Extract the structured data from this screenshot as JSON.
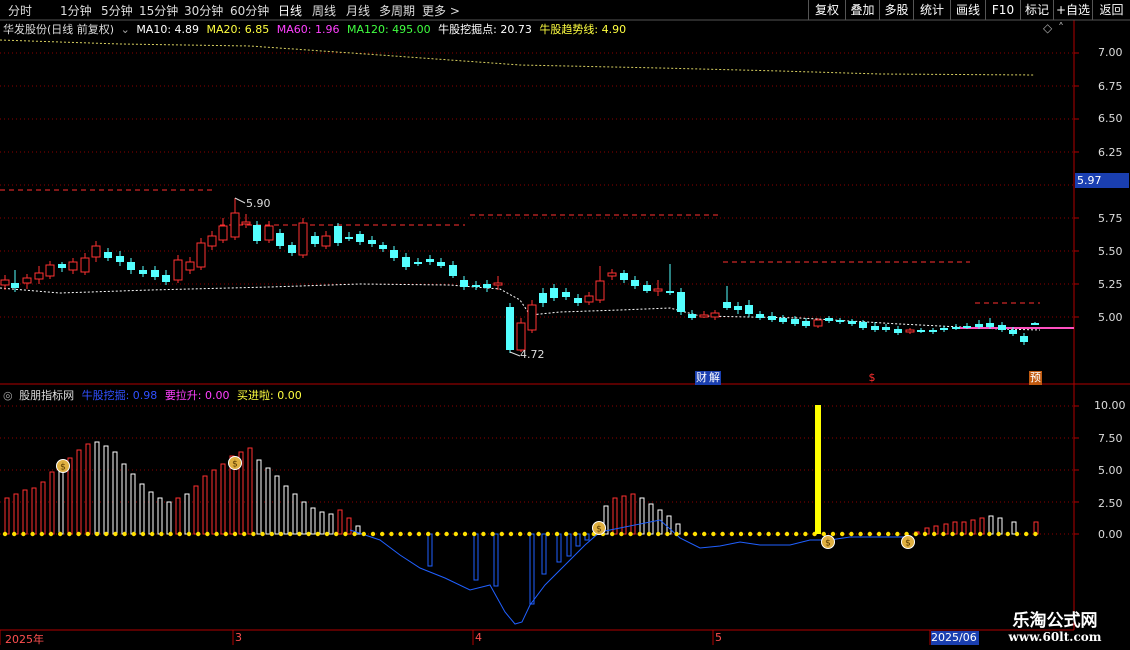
{
  "toolbar": {
    "periods": [
      "分时",
      "1分钟",
      "5分钟",
      "15分钟",
      "30分钟",
      "60分钟",
      "日线",
      "周线",
      "月线",
      "多周期",
      "更多 >"
    ],
    "active_period": "日线",
    "right_buttons": [
      "复权",
      "叠加",
      "多股",
      "统计",
      "画线",
      "F10",
      "标记",
      "+自选",
      "返回"
    ]
  },
  "main_panel": {
    "stock_title": "华发股份(日线 前复权)",
    "indicators": [
      {
        "label": "MA10: 4.89",
        "color": "#ffffff"
      },
      {
        "label": "MA20: 6.85",
        "color": "#ffff40"
      },
      {
        "label": "MA60: 1.96",
        "color": "#ff40ff"
      },
      {
        "label": "MA120: 495.00",
        "color": "#40ff40"
      },
      {
        "label": "牛股挖掘点: 20.73",
        "color": "#ffffff"
      },
      {
        "label": "牛股趋势线: 4.90",
        "color": "#ffff40"
      }
    ],
    "price_axis": [
      "7.00",
      "6.75",
      "6.50",
      "6.25",
      "5.75",
      "5.50",
      "5.25",
      "5.00"
    ],
    "current_price": "5.97",
    "high_mark": "5.90",
    "low_mark": "4.72",
    "event_tags": [
      "财",
      "解",
      "$",
      "预"
    ]
  },
  "sub_panel": {
    "title": "股朋指标网",
    "indicators": [
      {
        "label": "牛股挖掘: 0.98",
        "color": "#3050ff"
      },
      {
        "label": "要拉升: 0.00",
        "color": "#ff40ff"
      },
      {
        "label": "买进啦: 0.00",
        "color": "#ffff40"
      }
    ],
    "value_axis": [
      "10.00",
      "7.50",
      "5.00",
      "2.50",
      "0.00"
    ]
  },
  "date_axis": {
    "labels": [
      "2025年",
      "3",
      "4",
      "5"
    ],
    "end_label": "2025/06"
  },
  "watermark": {
    "line1": "乐淘公式网",
    "line2": "www.60lt.com"
  },
  "colors": {
    "up": "#ff3232",
    "down": "#54ffff",
    "grid": "#8b0000",
    "axis": "#b00000",
    "trend": "#ffff60",
    "sub_line": "#2060ff"
  }
}
